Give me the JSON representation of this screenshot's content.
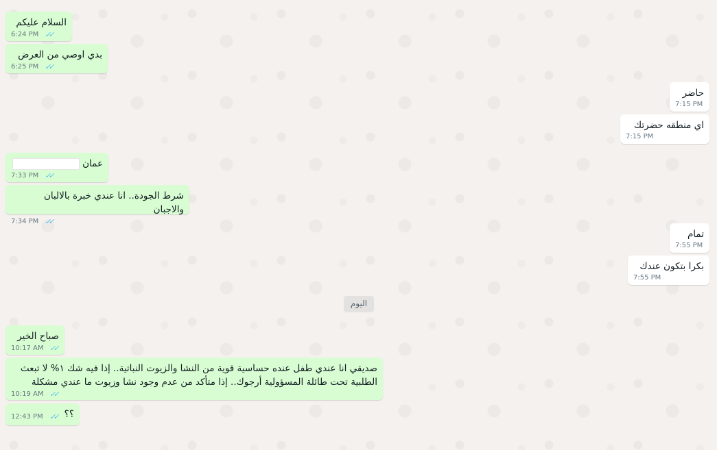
{
  "day_separator": "اليوم",
  "messages": [
    {
      "text": "السلام عليكم",
      "time": "6:24 PM",
      "ticks": "✓✓"
    },
    {
      "text": "بدي اوصي من العرض",
      "time": "6:25 PM",
      "ticks": "✓✓"
    },
    {
      "text": "حاضر",
      "time": "7:15 PM"
    },
    {
      "text": "اي منطقه حضرتك",
      "time": "7:15 PM"
    },
    {
      "text": "عمان",
      "time": "7:33 PM",
      "ticks": "✓✓"
    },
    {
      "text": "شرط الجودة.. انا عندي خبرة بالالبان والاجبان",
      "time": "7:34 PM",
      "ticks": "✓✓"
    },
    {
      "text": "تمام",
      "time": "7:55 PM"
    },
    {
      "text": "بكرا بتكون عندك",
      "time": "7:55 PM"
    },
    {
      "text": "صباح الخير",
      "time": "10:17 AM",
      "ticks": "✓✓"
    },
    {
      "text": "صديقي انا عندي طفل عنده حساسية قوية من النشا والزيوت النباتية.. إذا فيه شك ١% لا تبعث\nالطلبية تحت طائلة المسؤولية أرجوك.. إذا متأكد من عدم وجود نشا وزيوت ما عندي مشكلة",
      "time": "10:19 AM",
      "ticks": "✓✓"
    },
    {
      "text": "؟؟",
      "time": "12:43 PM",
      "ticks": "✓✓"
    }
  ]
}
